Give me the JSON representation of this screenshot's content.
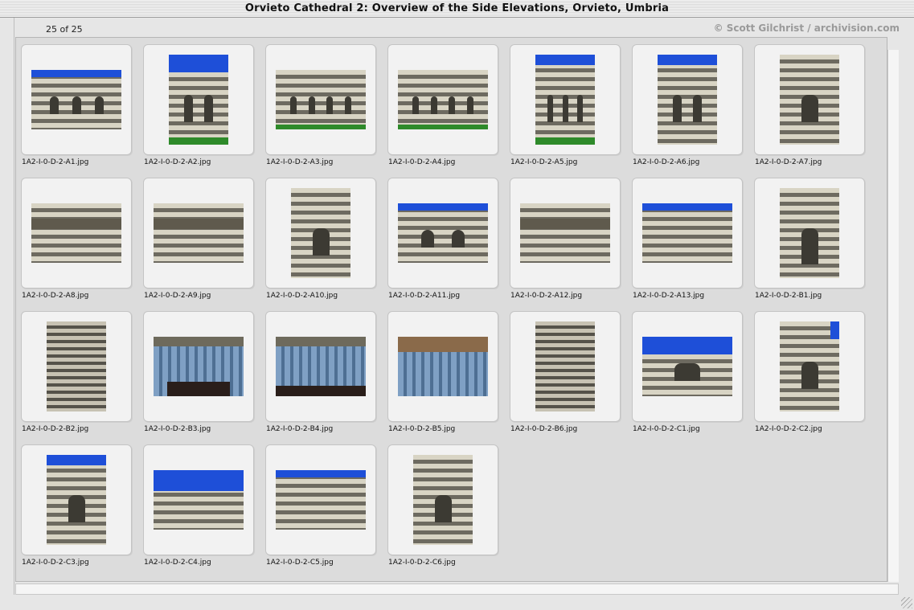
{
  "window": {
    "title": "Orvieto Cathedral 2: Overview of the Side Elevations, Orvieto, Umbria"
  },
  "header": {
    "count": "25 of 25",
    "credit": "© Scott Gilchrist / archivision.com"
  },
  "colors": {
    "panel": "#dcdcdc",
    "slide": "#f2f2f2",
    "sky": "#1e4fd8",
    "grass": "#2e8a2a",
    "credit_text": "#9a9a9a"
  },
  "thumbnails": [
    {
      "file": "1A2-I-0-D-2-A1.jpg",
      "orientation": "landscape",
      "subject": "side-elevation-sky"
    },
    {
      "file": "1A2-I-0-D-2-A2.jpg",
      "orientation": "portrait",
      "subject": "side-elevation-grass"
    },
    {
      "file": "1A2-I-0-D-2-A3.jpg",
      "orientation": "landscape",
      "subject": "chapels-grass"
    },
    {
      "file": "1A2-I-0-D-2-A4.jpg",
      "orientation": "landscape",
      "subject": "chapels-row"
    },
    {
      "file": "1A2-I-0-D-2-A5.jpg",
      "orientation": "portrait",
      "subject": "chapels-tall"
    },
    {
      "file": "1A2-I-0-D-2-A6.jpg",
      "orientation": "portrait",
      "subject": "apse-chapel"
    },
    {
      "file": "1A2-I-0-D-2-A7.jpg",
      "orientation": "portrait",
      "subject": "apse-chapel-detail"
    },
    {
      "file": "1A2-I-0-D-2-A8.jpg",
      "orientation": "landscape",
      "subject": "apse-roof"
    },
    {
      "file": "1A2-I-0-D-2-A9.jpg",
      "orientation": "landscape",
      "subject": "cornice-detail"
    },
    {
      "file": "1A2-I-0-D-2-A10.jpg",
      "orientation": "portrait",
      "subject": "window-detail"
    },
    {
      "file": "1A2-I-0-D-2-A11.jpg",
      "orientation": "landscape",
      "subject": "wall-windows-sky"
    },
    {
      "file": "1A2-I-0-D-2-A12.jpg",
      "orientation": "landscape",
      "subject": "wall-cornice"
    },
    {
      "file": "1A2-I-0-D-2-A13.jpg",
      "orientation": "landscape",
      "subject": "wall-sky-arch"
    },
    {
      "file": "1A2-I-0-D-2-B1.jpg",
      "orientation": "portrait",
      "subject": "side-portal"
    },
    {
      "file": "1A2-I-0-D-2-B2.jpg",
      "orientation": "portrait",
      "subject": "carved-pilaster"
    },
    {
      "file": "1A2-I-0-D-2-B3.jpg",
      "orientation": "landscape",
      "subject": "portal-lintel"
    },
    {
      "file": "1A2-I-0-D-2-B4.jpg",
      "orientation": "landscape",
      "subject": "lintel-relief"
    },
    {
      "file": "1A2-I-0-D-2-B5.jpg",
      "orientation": "landscape",
      "subject": "lintel-relief-close"
    },
    {
      "file": "1A2-I-0-D-2-B6.jpg",
      "orientation": "portrait",
      "subject": "portal-jamb"
    },
    {
      "file": "1A2-I-0-D-2-C1.jpg",
      "orientation": "landscape",
      "subject": "transept-gable"
    },
    {
      "file": "1A2-I-0-D-2-C2.jpg",
      "orientation": "portrait",
      "subject": "transept-wall"
    },
    {
      "file": "1A2-I-0-D-2-C3.jpg",
      "orientation": "portrait",
      "subject": "gable-corner"
    },
    {
      "file": "1A2-I-0-D-2-C4.jpg",
      "orientation": "landscape",
      "subject": "gable-top"
    },
    {
      "file": "1A2-I-0-D-2-C5.jpg",
      "orientation": "landscape",
      "subject": "cornice-sky"
    },
    {
      "file": "1A2-I-0-D-2-C6.jpg",
      "orientation": "portrait",
      "subject": "corner-oblique"
    }
  ]
}
